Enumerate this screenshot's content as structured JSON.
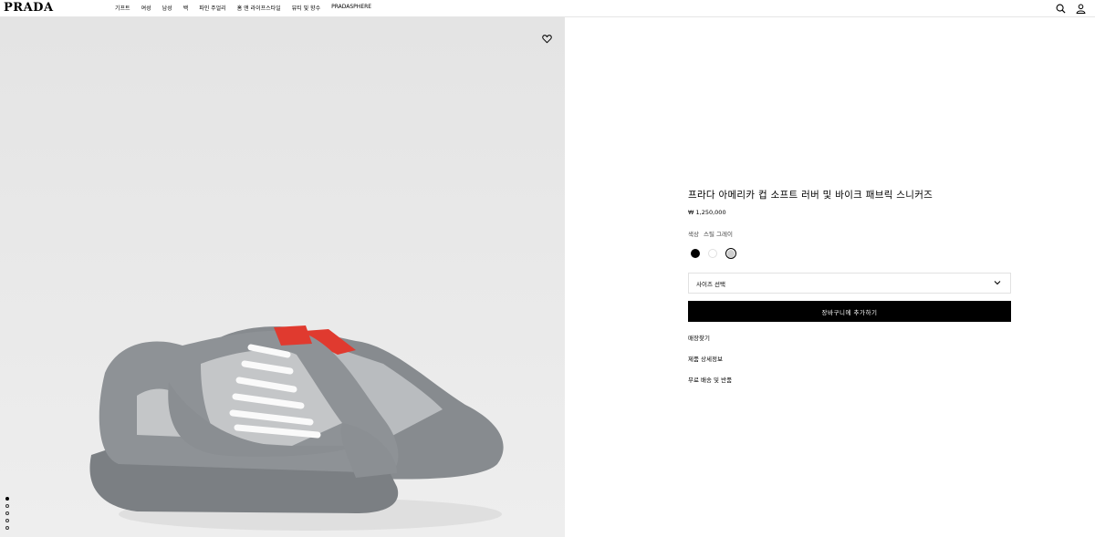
{
  "brand": {
    "logo": "PRADA"
  },
  "nav": {
    "items": [
      "기프트",
      "여성",
      "남성",
      "백",
      "파인 주얼리",
      "홈 앤 라이프스타일",
      "뷰티 및 향수",
      "PRADASPHERE"
    ]
  },
  "header_icons": [
    "search-icon",
    "account-icon"
  ],
  "gallery": {
    "wishlist_icon": "heart-icon",
    "pagination_count": 5,
    "active_index": 0
  },
  "product": {
    "title": "프라다 아메리카 컵 소프트 러버 및 바이크 패브릭 스니커즈",
    "price": "₩ 1,250,000",
    "color_label": "색상",
    "color_value": "스틸 그레이",
    "swatches": [
      {
        "name": "black",
        "color": "#000000"
      },
      {
        "name": "white",
        "color": "#ffffff"
      },
      {
        "name": "steel-grey",
        "color": "#cfcfcf",
        "selected": true
      }
    ],
    "size_placeholder": "사이즈 선택",
    "add_to_cart": "장바구니에 추가하기",
    "links": [
      "매장찾기",
      "제품 상세정보",
      "무료 배송 및 반품"
    ]
  }
}
